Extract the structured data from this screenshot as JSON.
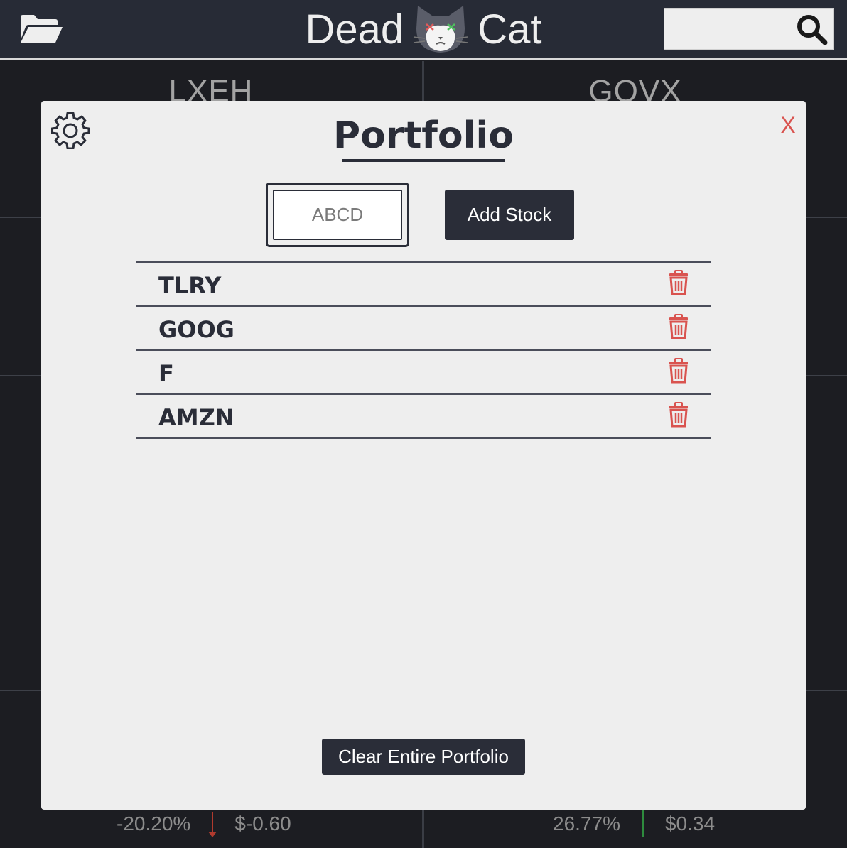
{
  "header": {
    "brand_left": "Dead",
    "brand_right": "Cat",
    "search_placeholder": "",
    "icons": [
      "folder-open-icon",
      "dead-cat-logo",
      "search-icon"
    ]
  },
  "background_tiles": {
    "left": {
      "symbol": "LXEH",
      "change_pct": "-20.20%",
      "change_value": "$-0.60"
    },
    "right": {
      "symbol": "GOVX",
      "change_pct": "26.77%",
      "change_value": "$0.34"
    }
  },
  "modal": {
    "title": "Portfolio",
    "close_label": "X",
    "ticker_placeholder": "ABCD",
    "add_label": "Add Stock",
    "clear_label": "Clear Entire Portfolio",
    "stocks": [
      "TLRY",
      "GOOG",
      "F",
      "AMZN"
    ]
  },
  "colors": {
    "header_bg": "#272b36",
    "page_bg": "#1c1d22",
    "modal_bg": "#eeeeee",
    "primary_dark": "#2a2d38",
    "danger": "#d9534f",
    "down": "#b03a2e",
    "up": "#2e8b3e"
  }
}
